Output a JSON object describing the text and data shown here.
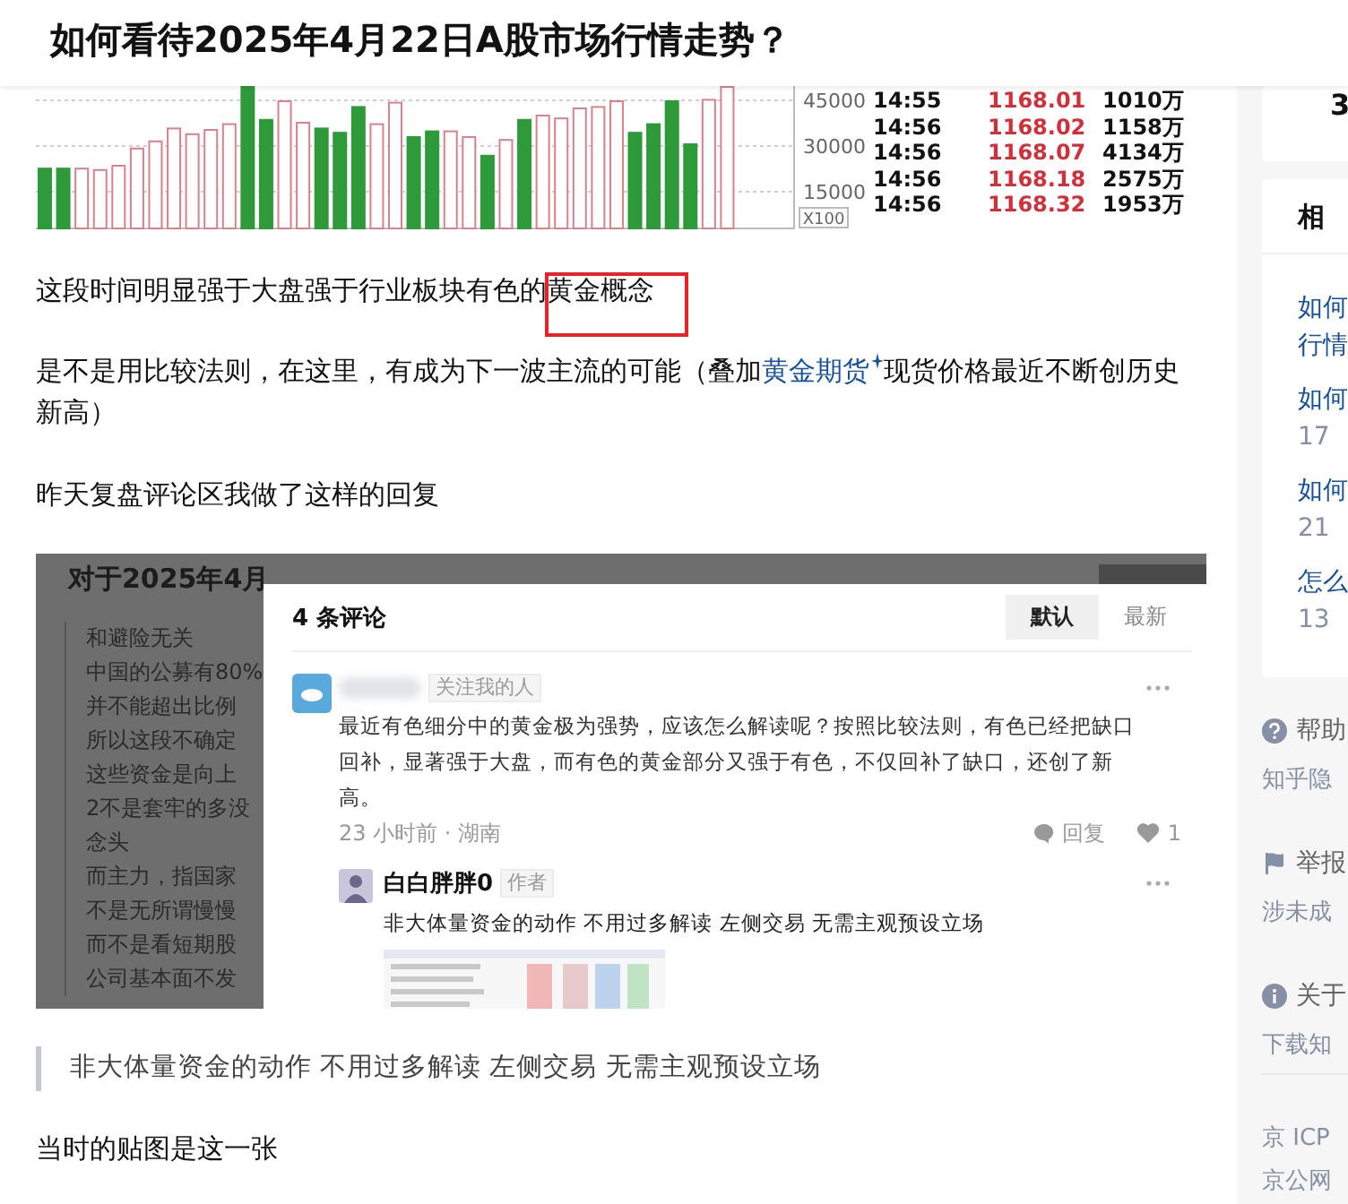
{
  "header": {
    "title": "如何看待2025年4月22日A股市场行情走势？"
  },
  "chart_image": {
    "tick_labels": [
      "45000",
      "30000",
      "15000"
    ],
    "scale_label": "X100",
    "trades": [
      {
        "time": "14:55",
        "price": "1168.01",
        "volume": "1010万"
      },
      {
        "time": "14:56",
        "price": "1168.02",
        "volume": "1158万"
      },
      {
        "time": "14:56",
        "price": "1168.07",
        "volume": "4134万"
      },
      {
        "time": "14:56",
        "price": "1168.18",
        "volume": "2575万"
      },
      {
        "time": "14:56",
        "price": "1168.32",
        "volume": "1953万"
      }
    ]
  },
  "paragraph_1": {
    "text": "这段时间明显强于大盘强于行业板块有色的黄金概念",
    "highlighted": true
  },
  "paragraph_2": {
    "before": "是不是用比较法则，在这里，有成为下一波主流的可能（叠加",
    "link": "黄金期货",
    "after": "现货价格最近不断创历史新高）"
  },
  "paragraph_3": "昨天复盘评论区我做了这样的回复",
  "comment_screenshot": {
    "background_title": "对于2025年4月",
    "background_lines": [
      "和避险无关",
      "中国的公募有80%",
      "并不能超出比例",
      "所以这段不确定",
      "这些资金是向上",
      "2不是套牢的多没",
      "念头",
      "而主力，指国家",
      "不是无所谓慢慢",
      "而不是看短期股",
      "公司基本面不发"
    ],
    "dialog": {
      "title": "4 条评论",
      "sort_tabs": [
        {
          "label": "默认",
          "selected": true
        },
        {
          "label": "最新",
          "selected": false
        }
      ],
      "comment": {
        "badge": "关注我的人",
        "text": "最近有色细分中的黄金极为强势，应该怎么解读呢？按照比较法则，有色已经把缺口回补，显著强于大盘，而有色的黄金部分又强于有色，不仅回补了缺口，还创了新高。",
        "meta": "23 小时前 · 湖南",
        "reply_label": "回复",
        "likes": "1"
      },
      "reply": {
        "author": "白白胖胖0",
        "badge": "作者",
        "text": "非大体量资金的动作 不用过多解读 左侧交易 无需主观预设立场"
      }
    }
  },
  "quote": "非大体量资金的动作 不用过多解读 左侧交易 无需主观预设立场",
  "paragraph_4": "当时的贴图是这一张",
  "sidebar": {
    "stat": "3",
    "related": {
      "title": "相",
      "items": [
        {
          "lines": [
            "如何",
            "行情"
          ]
        },
        {
          "lines": [
            "如何"
          ],
          "meta": "17"
        },
        {
          "lines": [
            "如何"
          ],
          "meta": "21"
        },
        {
          "lines": [
            "怎么"
          ],
          "meta": "13"
        }
      ]
    },
    "footer": [
      {
        "kind": "help",
        "label": "帮助",
        "link": "知乎隐"
      },
      {
        "kind": "report",
        "label": "举报",
        "link": "涉未成"
      },
      {
        "kind": "about",
        "label": "关于",
        "link": "下载知"
      }
    ],
    "licenses": [
      "京 ICP",
      "京公网"
    ]
  }
}
